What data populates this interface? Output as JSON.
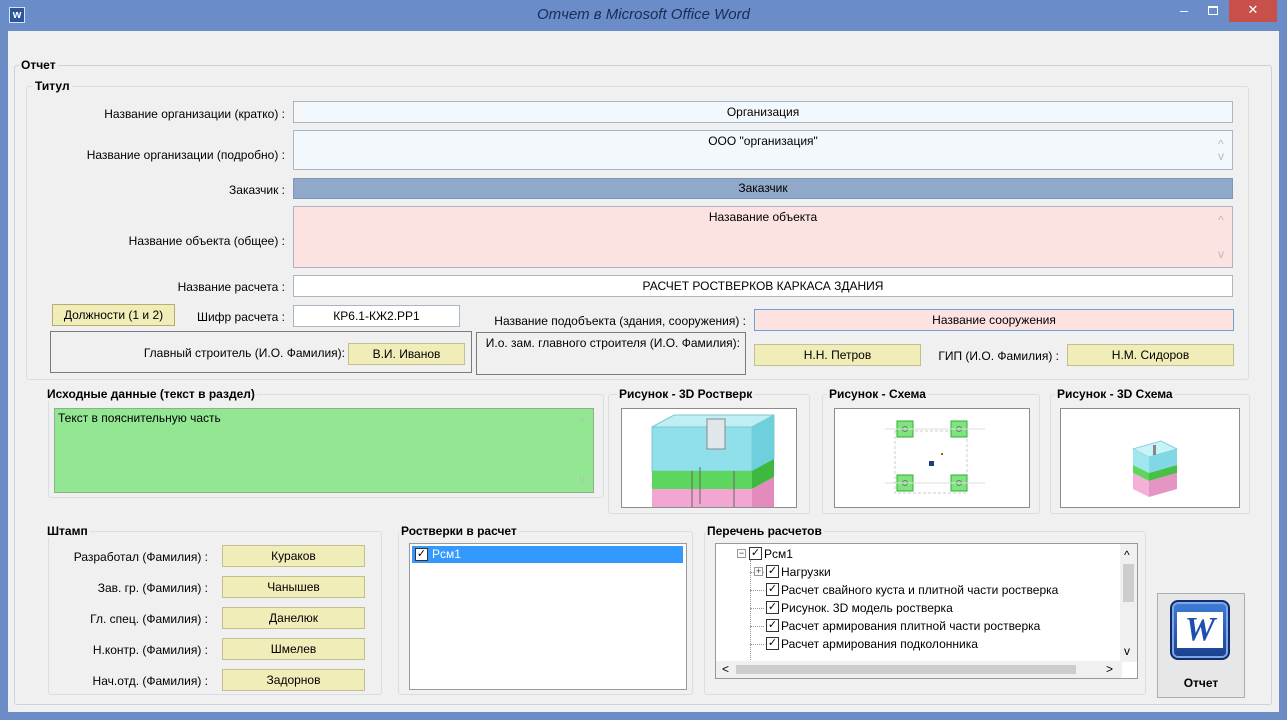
{
  "window": {
    "title": "Отчет в Microsoft Office Word",
    "icon": "word-app-icon",
    "min_glyph": "–",
    "close_glyph": "✕"
  },
  "report_group": {
    "legend": "Отчет"
  },
  "title_group": {
    "legend": "Титул",
    "org_short_label": "Название организации (кратко) :",
    "org_short_value": "Организация",
    "org_full_label": "Название организации (подробно) :",
    "org_full_value": "ООО \"организация\"",
    "customer_label": "Заказчик :",
    "customer_value": "Заказчик",
    "object_label": "Название объекта (общее) :",
    "object_value": "Назавание объекта",
    "calc_name_label": "Название расчета :",
    "calc_name_value": "РАСЧЕТ РОСТВЕРКОВ КАРКАСА ЗДАНИЯ",
    "positions_button": "Должности (1 и 2)",
    "cipher_label": "Шифр расчета :",
    "cipher_value": "КР6.1-КЖ2.РР1",
    "subobject_label": "Название подобъекта (здания, сооружения) :",
    "subobject_value": "Название сооружения",
    "chief_builder_label": "Главный строитель (И.О. Фамилия):",
    "chief_builder_value": "В.И. Иванов",
    "deputy_label": "И.о. зам. главного строителя (И.О. Фамилия):",
    "deputy_value": "Н.Н. Петров",
    "gip_label": "ГИП (И.О. Фамилия) :",
    "gip_value": "Н.М. Сидоров"
  },
  "source_group": {
    "legend": "Исходные данные (текст в раздел)",
    "text": "Текст в пояснительную часть"
  },
  "pictures": {
    "pic1_legend": "Рисунок - 3D Ростверк",
    "pic2_legend": "Рисунок - Схема",
    "pic3_legend": "Рисунок - 3D Схема"
  },
  "stamp_group": {
    "legend": "Штамп",
    "rows": [
      {
        "label": "Разработал (Фамилия) :",
        "value": "Кураков"
      },
      {
        "label": "Зав. гр. (Фамилия) :",
        "value": "Чанышев"
      },
      {
        "label": "Гл. спец. (Фамилия) :",
        "value": "Данелюк"
      },
      {
        "label": "Н.контр. (Фамилия) :",
        "value": "Шмелев"
      },
      {
        "label": "Нач.отд. (Фамилия) :",
        "value": "Задорнов"
      }
    ]
  },
  "grillages_group": {
    "legend": "Ростверки в расчет",
    "items": [
      {
        "label": "Рсм1",
        "checked": true,
        "selected": true
      }
    ]
  },
  "calcs_group": {
    "legend": "Перечень расчетов",
    "tree": [
      {
        "label": "Рсм1",
        "level": 0,
        "expander": "−",
        "checked": true
      },
      {
        "label": "Нагрузки",
        "level": 1,
        "expander": "+",
        "checked": true
      },
      {
        "label": "Расчет свайного куста и плитной части ростверка",
        "level": 1,
        "checked": true
      },
      {
        "label": "Рисунок. 3D модель ростверка",
        "level": 1,
        "checked": true
      },
      {
        "label": "Расчет армирования плитной части ростверка",
        "level": 1,
        "checked": true
      },
      {
        "label": "Расчет армирования подколонника",
        "level": 1,
        "checked": true
      }
    ]
  },
  "report_button": {
    "label": "Отчет",
    "icon": "word-icon",
    "glyph": "W"
  },
  "scroll_glyphs": {
    "up": "^",
    "down": "v",
    "left": "<",
    "right": ">"
  },
  "check_glyph": "✓",
  "colors": {
    "customer_field": "#91a9c9",
    "pink_field": "#fde2e2",
    "yellow_field": "#f1edb8",
    "green_text_area": "#93e793",
    "selection": "#3399ff"
  }
}
